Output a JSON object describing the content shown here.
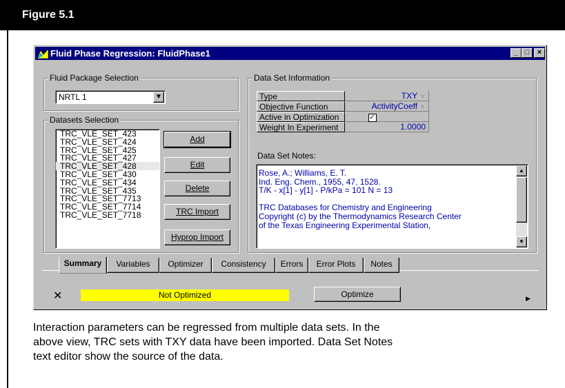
{
  "figure": {
    "title": "Figure 5.1"
  },
  "window": {
    "title": "Fluid Phase Regression:  FluidPhase1",
    "controls": [
      "minimize",
      "maximize",
      "close"
    ]
  },
  "fluid_package": {
    "label": "Fluid Package Selection",
    "selected": "NRTL 1"
  },
  "datasets": {
    "label": "Datasets Selection",
    "items": [
      "TRC_VLE_SET_423",
      "TRC_VLE_SET_424",
      "TRC_VLE_SET_425",
      "TRC_VLE_SET_427",
      "TRC_VLE_SET_428",
      "TRC_VLE_SET_430",
      "TRC_VLE_SET_434",
      "TRC_VLE_SET_435",
      "TRC_VLE_SET_7713",
      "TRC_VLE_SET_7714",
      "TRC_VLE_SET_7718"
    ],
    "selected_index": 4
  },
  "buttons": {
    "add": "Add",
    "edit": "Edit",
    "delete": "Delete",
    "trc_import": "TRC Import",
    "hyprop_import": "Hyprop Import"
  },
  "data_set_info": {
    "label": "Data Set Information",
    "rows": [
      {
        "label": "Type",
        "value": "TXY"
      },
      {
        "label": "Objective Function",
        "value": "ActivityCoeff"
      },
      {
        "label": "Active in Optimization",
        "value": "checked"
      },
      {
        "label": "Weight In Experiment",
        "value": "1.0000"
      }
    ]
  },
  "notes": {
    "label": "Data Set Notes:",
    "lines": [
      "Rose, A.; Williams, E. T.",
      "Ind. Eng. Chem., 1955, 47, 1528.",
      "T/K - x[1] - y[1]  - P/kPa = 101  N = 13",
      "",
      "TRC Databases for Chemistry and Engineering",
      "Copyright (c) by the Thermodynamics Research Center",
      "of the Texas Engineering Experimental Station,"
    ]
  },
  "tabs": [
    "Summary",
    "Variables",
    "Optimizer",
    "Consistency",
    "Errors",
    "Error Plots",
    "Notes"
  ],
  "active_tab": "Summary",
  "status": {
    "text": "Not Optimized",
    "color": "#ffff00"
  },
  "optimize_button": "Optimize",
  "caption": [
    "Interaction parameters can be regressed from multiple data sets. In the",
    "above view, TRC sets with TXY data have been imported. Data Set Notes",
    "text editor show the source of the data."
  ]
}
